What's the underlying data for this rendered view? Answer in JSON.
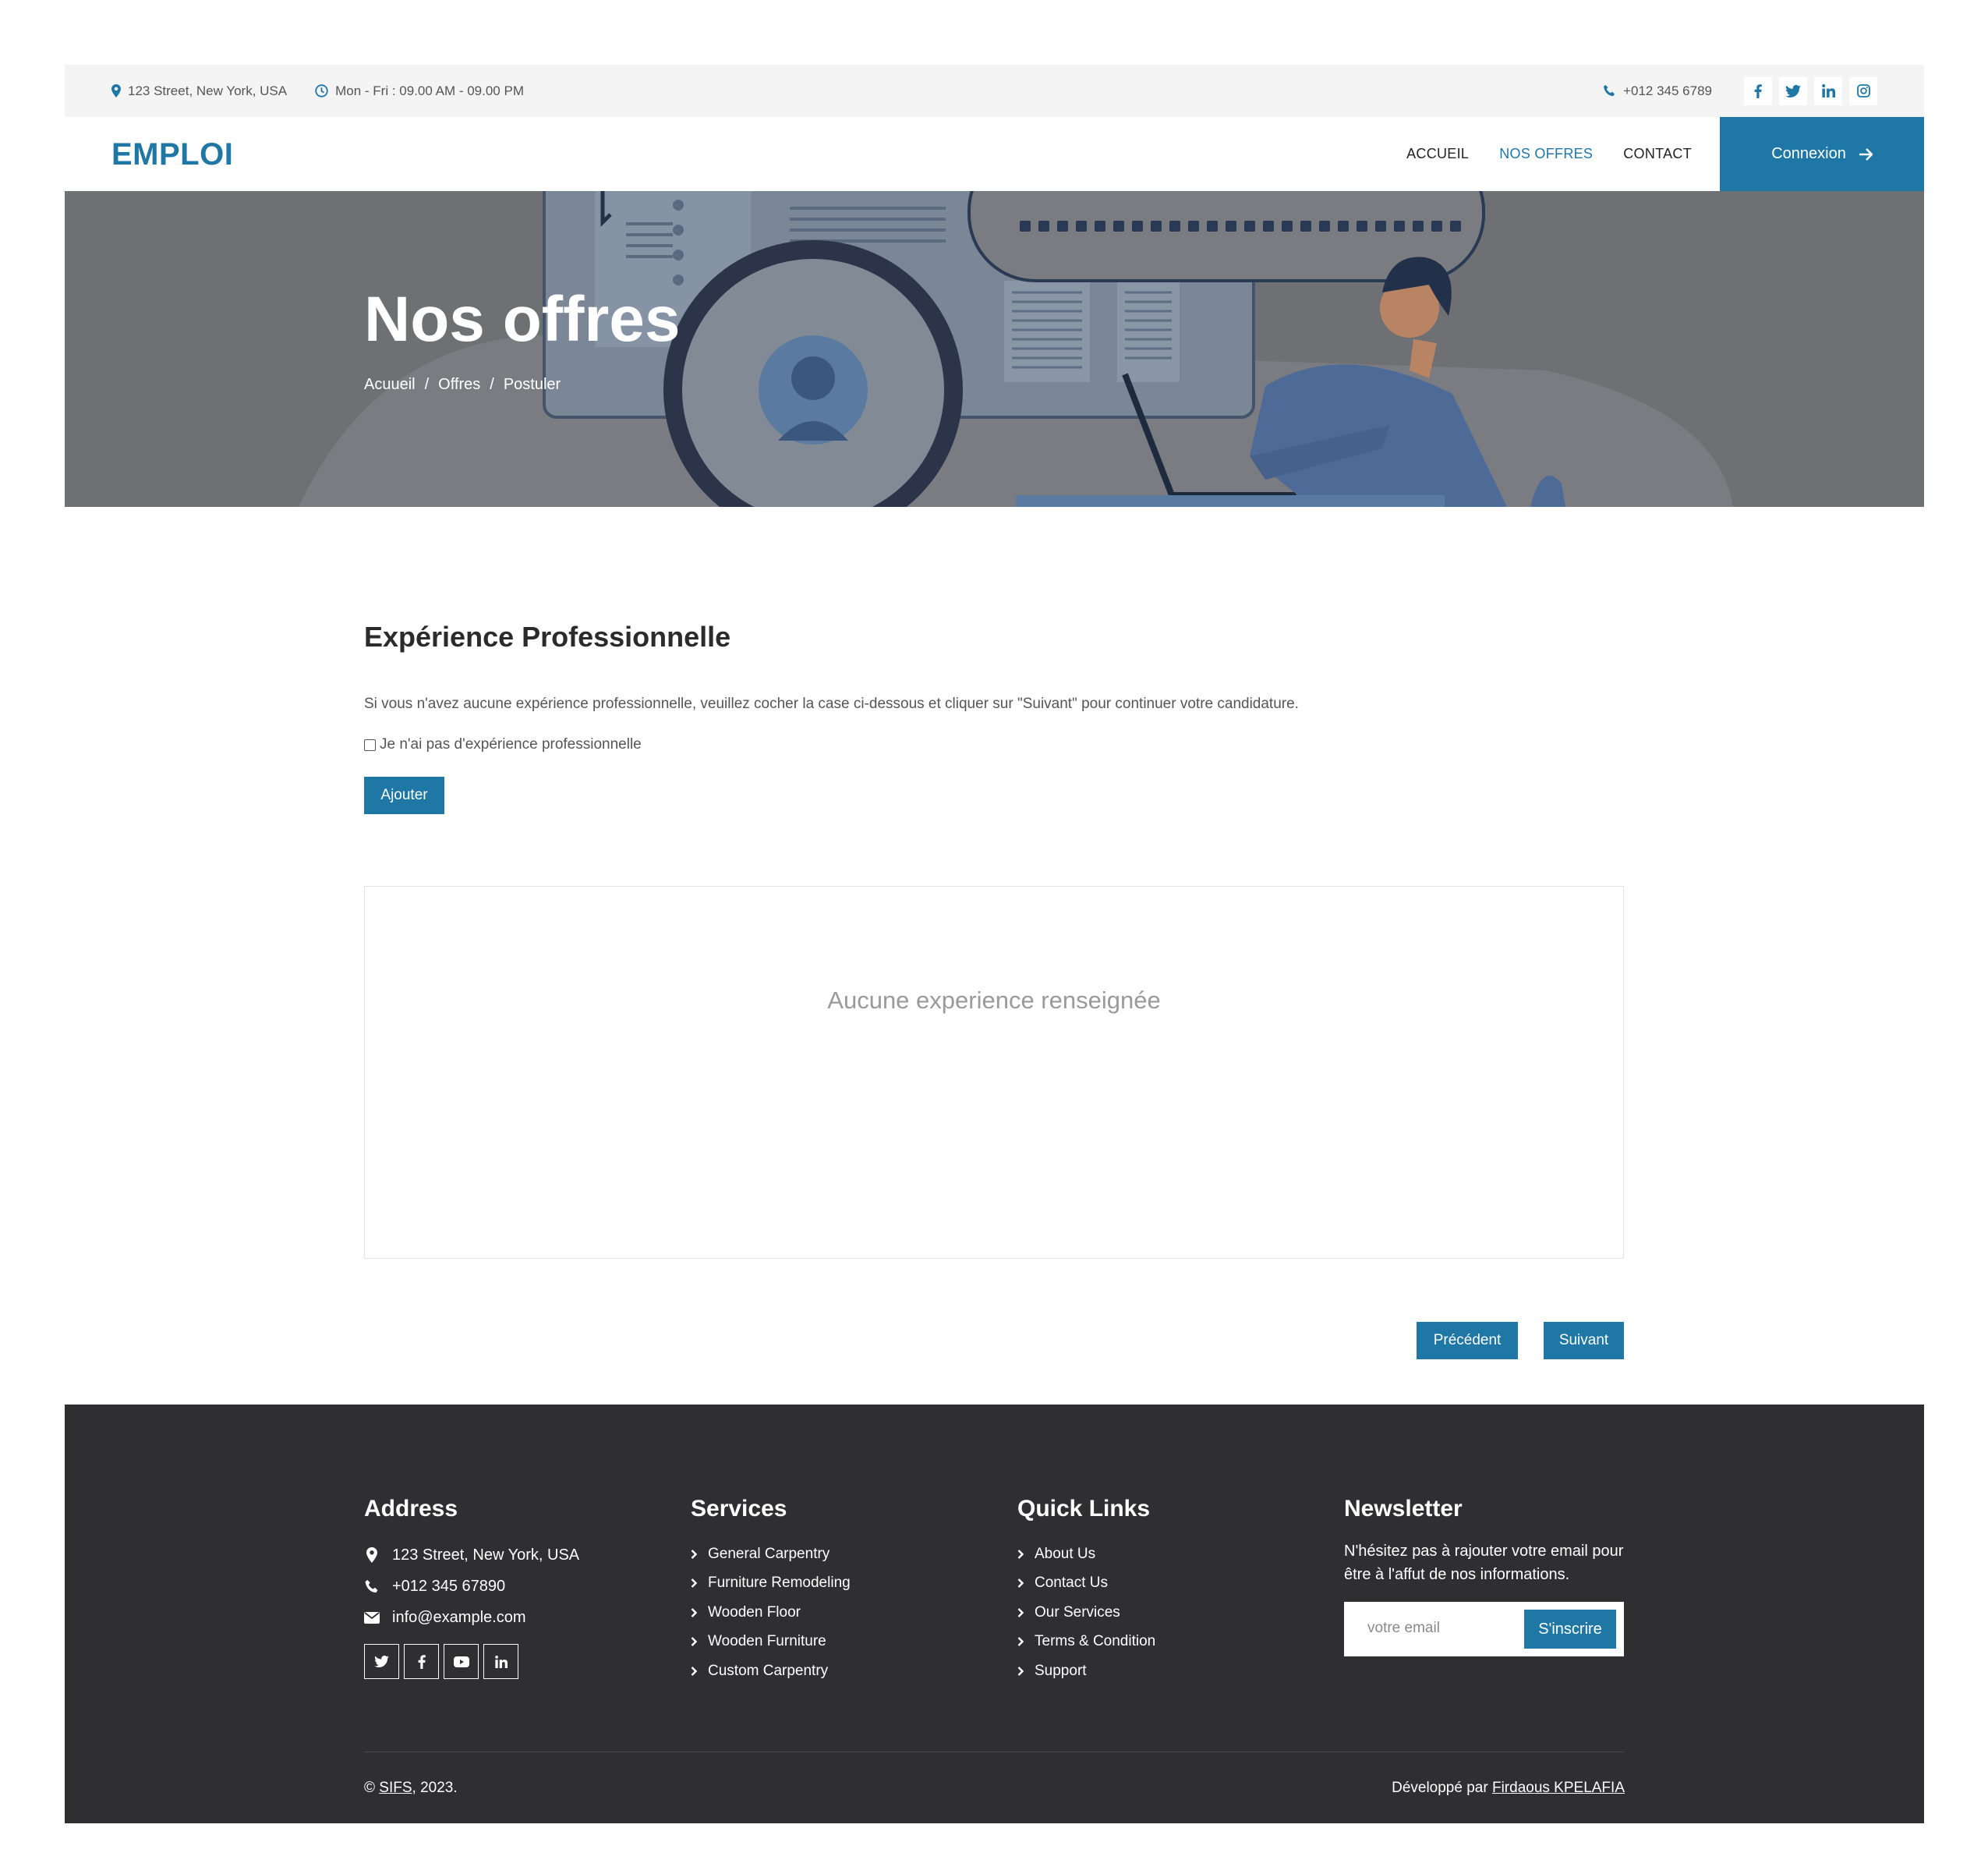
{
  "topbar": {
    "address": "123 Street, New York, USA",
    "hours": "Mon - Fri : 09.00 AM - 09.00 PM",
    "phone": "+012 345 6789",
    "socials": [
      "facebook-icon",
      "twitter-icon",
      "linkedin-icon",
      "instagram-icon"
    ]
  },
  "brand": {
    "logo": "EMPLOI",
    "accent_color": "#1f77a6"
  },
  "nav": {
    "links": [
      "ACCUEIL",
      "NOS OFFRES",
      "CONTACT"
    ],
    "active": "NOS OFFRES",
    "login_label": "Connexion"
  },
  "hero": {
    "title": "Nos offres",
    "breadcrumb": [
      "Acuueil",
      "Offres",
      "Postuler"
    ],
    "separator": "/"
  },
  "main": {
    "section_title": "Expérience Professionnelle",
    "intro": "Si vous n'avez aucune expérience professionnelle, veuillez cocher la case ci-dessous et cliquer sur \"Suivant\" pour continuer votre candidature.",
    "checkbox_label": "Je n'ai pas d'expérience professionnelle",
    "checkbox_checked": false,
    "add_label": "Ajouter",
    "empty_text": "Aucune experience renseignée",
    "prev_label": "Précédent",
    "next_label": "Suivant"
  },
  "footer": {
    "address": {
      "title": "Address",
      "street": "123 Street, New York, USA",
      "phone": "+012 345 67890",
      "email": "info@example.com",
      "socials": [
        "twitter-icon",
        "facebook-icon",
        "youtube-icon",
        "linkedin-icon"
      ]
    },
    "services": {
      "title": "Services",
      "items": [
        "General Carpentry",
        "Furniture Remodeling",
        "Wooden Floor",
        "Wooden Furniture",
        "Custom Carpentry"
      ]
    },
    "quick_links": {
      "title": "Quick Links",
      "items": [
        "About Us",
        "Contact Us",
        "Our Services",
        "Terms & Condition",
        "Support"
      ]
    },
    "newsletter": {
      "title": "Newsletter",
      "text": "N'hésitez pas à rajouter votre email pour être à l'affut de nos informations.",
      "placeholder": "votre email",
      "button": "S'inscrire"
    },
    "copyright_prefix": "©",
    "copyright_brand": "SIFS",
    "copyright_suffix": ", 2023.",
    "dev_prefix": "Développé par",
    "dev_name": "Firdaous KPELAFIA"
  }
}
